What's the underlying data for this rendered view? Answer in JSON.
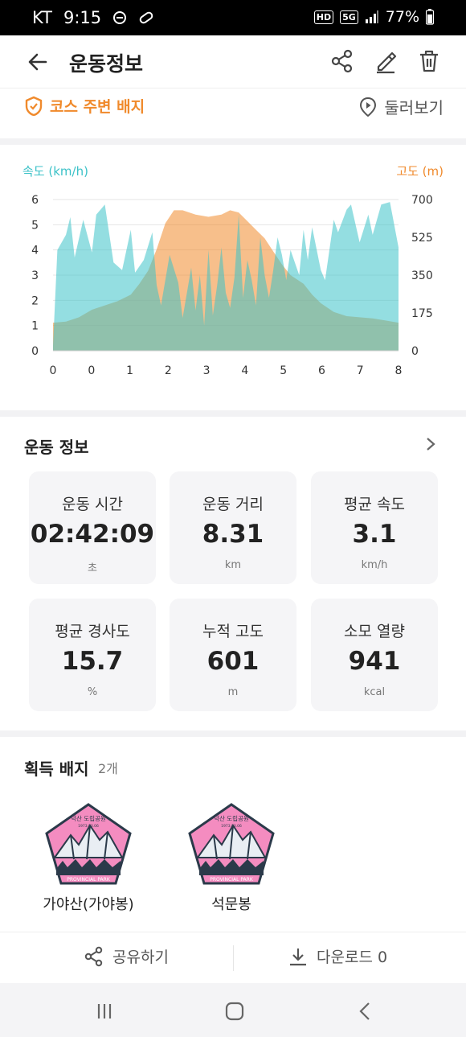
{
  "status_bar": {
    "carrier": "KT",
    "time": "9:15",
    "hd_badge": "HD",
    "network_badge": "5G",
    "battery": "77%"
  },
  "app_bar": {
    "title": "운동정보",
    "icons": [
      "back-arrow-icon",
      "share-icon",
      "edit-icon",
      "trash-icon"
    ]
  },
  "course_row": {
    "course_badge_label": "코스 주변 배지",
    "preview_label": "둘러보기",
    "accent_color": "#f08a2c"
  },
  "chart_data": {
    "type": "area",
    "left_axis_label": "속도 (km/h)",
    "right_axis_label": "고도 (m)",
    "left_color": "#3cc2c8",
    "right_color": "#f08a2c",
    "x_ticks": [
      "0",
      "0",
      "1",
      "2",
      "3",
      "4",
      "5",
      "6",
      "7",
      "8"
    ],
    "y_left_ticks": [
      "6",
      "5",
      "4",
      "3",
      "2",
      "1",
      "0"
    ],
    "y_right_ticks": [
      "700",
      "525",
      "350",
      "175",
      "0"
    ],
    "ylim_left": [
      0,
      6
    ],
    "ylim_right": [
      0,
      700
    ],
    "grid": true,
    "series": [
      {
        "axis": "left",
        "x": [
          0,
          0.1,
          0.3,
          0.4,
          0.5,
          0.7,
          0.9,
          1.0,
          1.2,
          1.4,
          1.6,
          1.8,
          1.9,
          2.1,
          2.3,
          2.4,
          2.5,
          2.7,
          2.9,
          3.0,
          3.2,
          3.3,
          3.4,
          3.5,
          3.6,
          3.7,
          3.8,
          3.9,
          4.0,
          4.1,
          4.2,
          4.3,
          4.4,
          4.5,
          4.6,
          4.7,
          4.8,
          4.9,
          5.0,
          5.1,
          5.2,
          5.3,
          5.4,
          5.5,
          5.7,
          5.8,
          5.9,
          6.0,
          6.2,
          6.3,
          6.5,
          6.6,
          6.8,
          6.9,
          7.1,
          7.3,
          7.4,
          7.6,
          7.8,
          8.0
        ],
        "values": [
          0.2,
          4.0,
          4.6,
          5.3,
          3.7,
          5.2,
          3.9,
          5.4,
          5.8,
          3.5,
          3.2,
          4.8,
          3.1,
          3.6,
          4.7,
          2.6,
          1.8,
          3.8,
          2.7,
          1.3,
          3.3,
          1.6,
          3.0,
          1.0,
          4.0,
          1.4,
          2.6,
          4.1,
          2.3,
          1.7,
          2.9,
          5.4,
          2.1,
          3.6,
          2.8,
          1.8,
          4.5,
          3.0,
          2.1,
          3.2,
          4.5,
          3.8,
          2.8,
          4.0,
          3.0,
          4.8,
          3.6,
          4.9,
          3.2,
          2.8,
          5.2,
          4.7,
          5.6,
          5.8,
          4.3,
          5.4,
          4.6,
          5.8,
          5.9,
          4.1
        ]
      },
      {
        "axis": "right",
        "x": [
          0,
          0.3,
          0.6,
          0.9,
          1.2,
          1.5,
          1.8,
          2.0,
          2.2,
          2.4,
          2.6,
          2.8,
          3.0,
          3.3,
          3.6,
          3.9,
          4.1,
          4.3,
          4.5,
          4.7,
          4.9,
          5.1,
          5.3,
          5.5,
          5.8,
          6.0,
          6.2,
          6.5,
          6.8,
          7.1,
          7.4,
          7.7,
          8.0
        ],
        "values": [
          130,
          135,
          155,
          190,
          210,
          230,
          260,
          310,
          370,
          470,
          590,
          650,
          650,
          630,
          620,
          630,
          650,
          640,
          600,
          560,
          520,
          460,
          400,
          350,
          310,
          260,
          220,
          180,
          160,
          155,
          150,
          140,
          130
        ]
      }
    ]
  },
  "stats": {
    "title": "운동 정보",
    "cards": [
      {
        "label": "운동 시간",
        "value": "02:42:09",
        "unit": "초"
      },
      {
        "label": "운동 거리",
        "value": "8.31",
        "unit": "km"
      },
      {
        "label": "평균 속도",
        "value": "3.1",
        "unit": "km/h"
      },
      {
        "label": "평균 경사도",
        "value": "15.7",
        "unit": "%"
      },
      {
        "label": "누적 고도",
        "value": "601",
        "unit": "m"
      },
      {
        "label": "소모 열량",
        "value": "941",
        "unit": "kcal"
      }
    ]
  },
  "badges": {
    "title": "획득 배지",
    "count": "2개",
    "items": [
      {
        "name": "가야산(가야봉)",
        "emblem_text": "덕산 도립공원",
        "emblem_year": "1973.03.06",
        "emblem_footer": "PROVINCIAL PARK",
        "color": "#f48cc0"
      },
      {
        "name": "석문봉",
        "emblem_text": "덕산 도립공원",
        "emblem_year": "1973.03.06",
        "emblem_footer": "PROVINCIAL PARK",
        "color": "#f48cc0"
      }
    ]
  },
  "bottom_actions": {
    "share_label": "공유하기",
    "download_label": "다운로드 0"
  }
}
